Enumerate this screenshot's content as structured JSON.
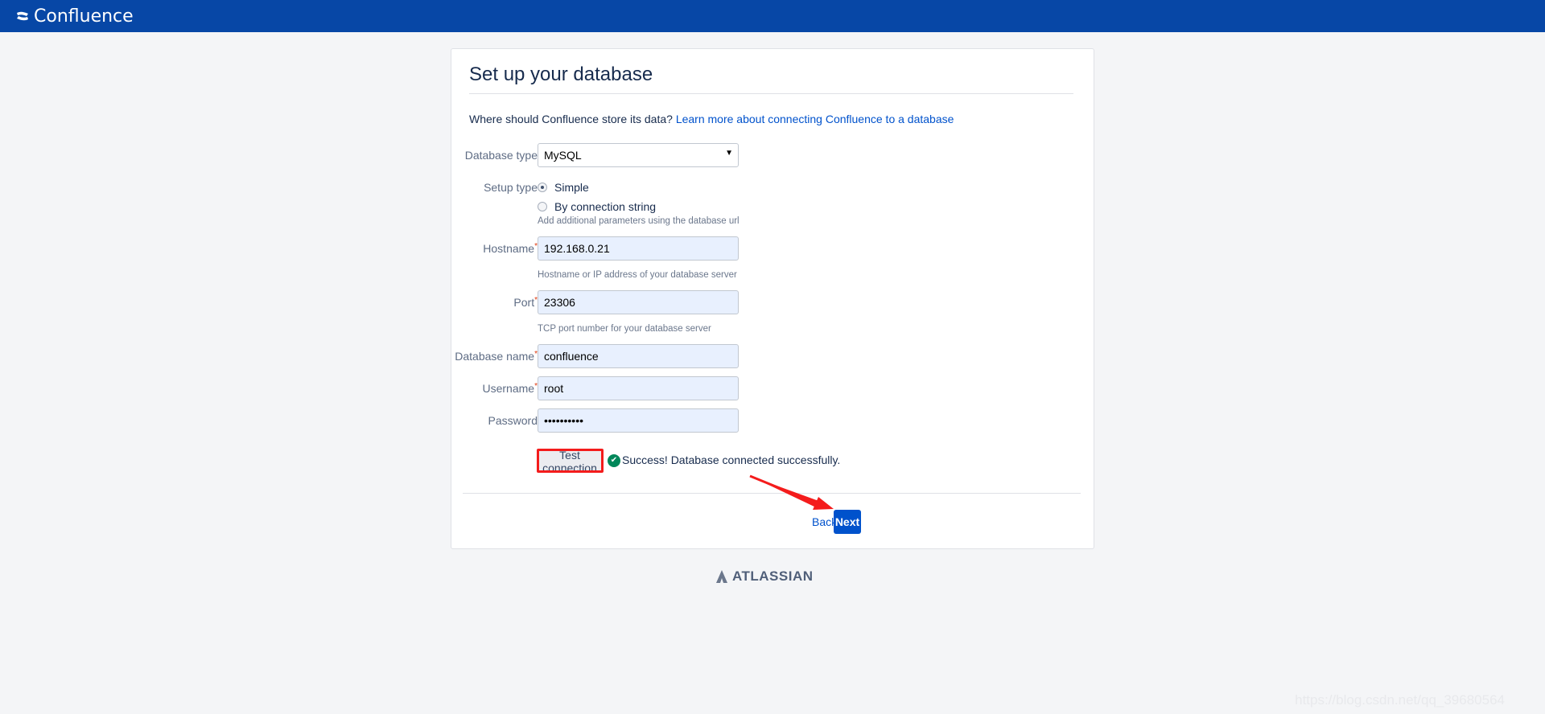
{
  "header": {
    "app_name": "Confluence",
    "logo_icon": "confluence-logo-icon",
    "bg_color": "#0747a6"
  },
  "page": {
    "title": "Set up your database",
    "intro": "Where should Confluence store its data?",
    "learn_more_link": "Learn more about connecting Confluence to a database"
  },
  "form": {
    "database_type": {
      "label": "Database type",
      "value": "MySQL"
    },
    "setup_type": {
      "label": "Setup type",
      "options": [
        {
          "label": "Simple",
          "selected": true
        },
        {
          "label": "By connection string",
          "selected": false
        }
      ],
      "help": "Add additional parameters using the database url"
    },
    "hostname": {
      "label": "Hostname",
      "required": "*",
      "value": "192.168.0.21",
      "help": "Hostname or IP address of your database server"
    },
    "port": {
      "label": "Port",
      "required": "*",
      "value": "23306",
      "help": "TCP port number for your database server"
    },
    "database_name": {
      "label": "Database name",
      "required": "*",
      "value": "confluence"
    },
    "username": {
      "label": "Username",
      "required": "*",
      "value": "root"
    },
    "password": {
      "label": "Password",
      "value": "••••••••••"
    }
  },
  "test": {
    "button": "Test connection",
    "status_icon": "check-circle-icon",
    "status": "Success! Database connected successfully.",
    "status_color": "#00875a"
  },
  "footer": {
    "back": "Back",
    "next": "Next",
    "accent": "#0052cc"
  },
  "brand": {
    "name": "ATLASSIAN"
  },
  "annotation": {
    "highlight_color": "#f41c1c"
  },
  "watermark": "https://blog.csdn.net/qq_39680564"
}
